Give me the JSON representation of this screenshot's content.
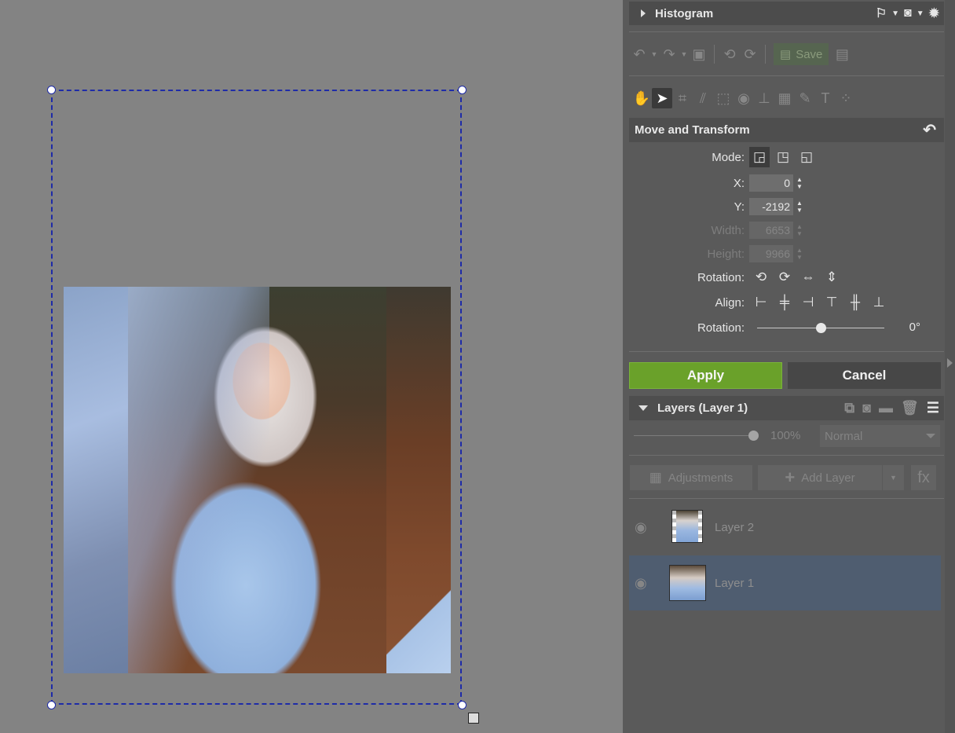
{
  "histogram": {
    "title": "Histogram"
  },
  "toolbar": {
    "save_label": "Save"
  },
  "move_transform": {
    "title": "Move and Transform",
    "mode_label": "Mode:",
    "x_label": "X:",
    "x_value": "0",
    "y_label": "Y:",
    "y_value": "-2192",
    "width_label": "Width:",
    "width_value": "6653",
    "height_label": "Height:",
    "height_value": "9966",
    "rotation_label": "Rotation:",
    "align_label": "Align:",
    "rotation2_label": "Rotation:",
    "rotation_value": "0°",
    "rotation_slider_fraction": 0.5
  },
  "actions": {
    "apply": "Apply",
    "cancel": "Cancel"
  },
  "layers": {
    "title": "Layers (Layer 1)",
    "opacity": "100%",
    "opacity_fraction": 1.0,
    "blend_mode": "Normal",
    "adjustments_label": "Adjustments",
    "add_layer_label": "Add Layer",
    "fx_label": "fx",
    "items": [
      {
        "name": "Layer 2",
        "selected": false
      },
      {
        "name": "Layer 1",
        "selected": true
      }
    ]
  },
  "colors": {
    "apply": "#6aa12a",
    "selection": "#1e2ba8",
    "selected_layer": "#4f5d70"
  }
}
